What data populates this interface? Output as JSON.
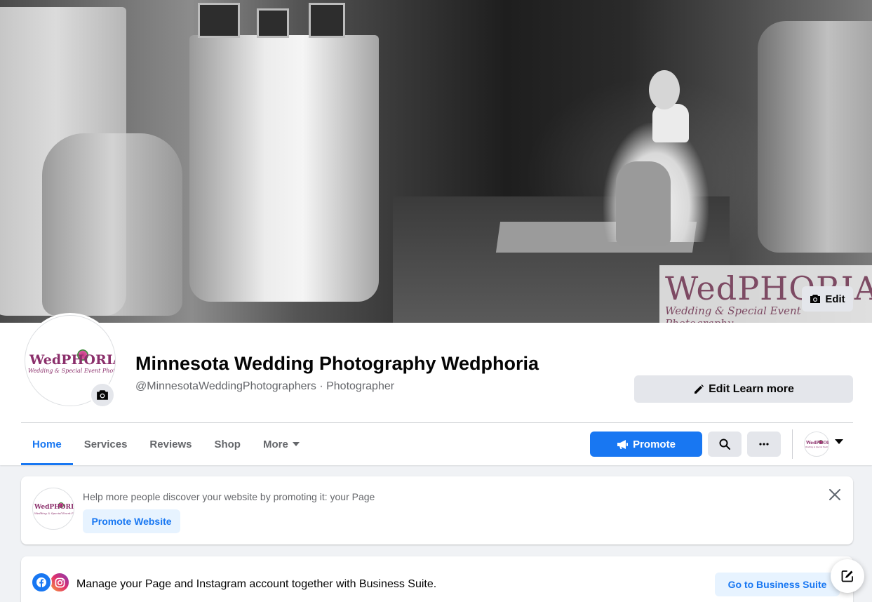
{
  "cover": {
    "watermark_title": "WedPHORIA",
    "watermark_subtitle": "Wedding & Special Event Photography",
    "edit_label": "Edit"
  },
  "profile": {
    "logo_title": "WedPHORIA",
    "logo_subtitle": "Wedding & Special Event Photography",
    "name": "Minnesota Wedding Photography Wedphoria",
    "subtitle": "@MinnesotaWeddingPhotographers · Photographer"
  },
  "actions": {
    "edit_learn_more_label": "Edit Learn more",
    "promote_label": "Promote"
  },
  "tabs": [
    {
      "label": "Home",
      "active": true
    },
    {
      "label": "Services"
    },
    {
      "label": "Reviews"
    },
    {
      "label": "Shop"
    },
    {
      "label": "More"
    }
  ],
  "promo_card": {
    "text": "Help more people discover your website by promoting it: your Page",
    "button_label": "Promote Website"
  },
  "business_card": {
    "text": "Manage your Page and Instagram account together with Business Suite.",
    "button_label": "Go to Business Suite"
  },
  "colors": {
    "accent": "#1877f2",
    "accent_light": "#e7f3ff",
    "button_gray": "#e4e6eb",
    "background": "#f0f2f5",
    "secondary_text": "#65676b",
    "logo_magenta": "#8b2f6b"
  },
  "icons": {
    "camera": "camera-icon",
    "pencil": "pencil-icon",
    "megaphone": "megaphone-icon",
    "search": "search-icon",
    "more": "more-dots-icon",
    "caret": "caret-down-icon",
    "close": "close-icon",
    "facebook": "facebook-icon",
    "instagram": "instagram-icon",
    "compose": "compose-icon"
  }
}
